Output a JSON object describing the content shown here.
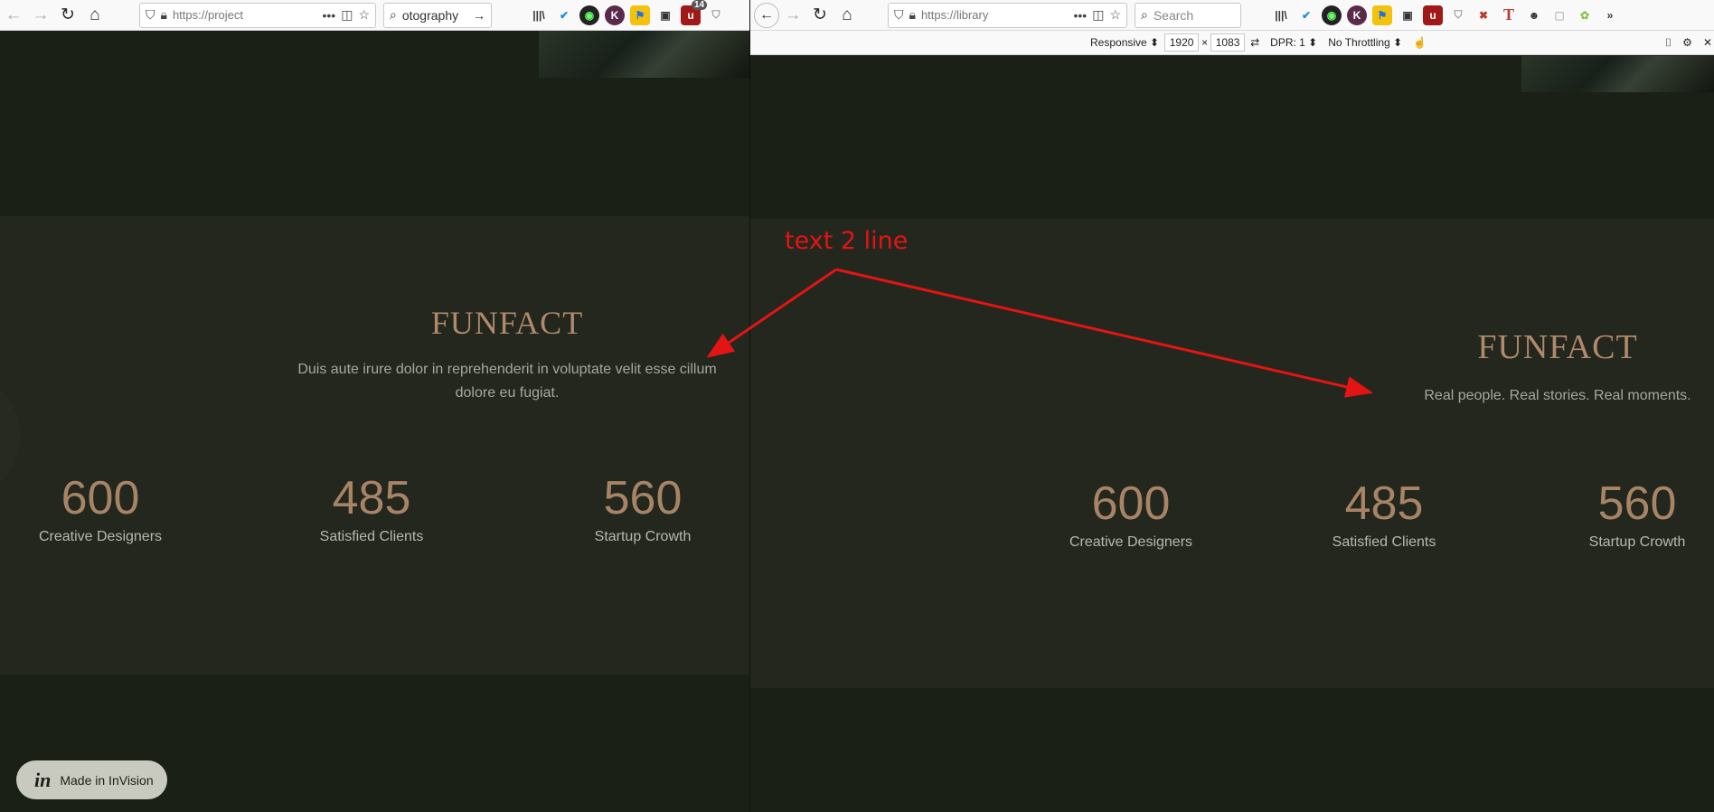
{
  "left": {
    "toolbar": {
      "url": "https://project",
      "search_text": "otography",
      "badge_count": "14"
    },
    "section": {
      "heading": "FUNFACT",
      "description": "Duis aute irure dolor in reprehenderit in voluptate velit esse cillum dolore eu fugiat."
    },
    "stats": [
      {
        "value": "600",
        "label": "Creative Designers"
      },
      {
        "value": "485",
        "label": "Satisfied Clients"
      },
      {
        "value": "560",
        "label": "Startup Crowth"
      }
    ],
    "invision_label": "Made in InVision"
  },
  "right": {
    "toolbar": {
      "url": "https://library",
      "search_placeholder": "Search"
    },
    "rdm": {
      "device": "Responsive ⬍",
      "width": "1920",
      "times": "×",
      "height": "1083",
      "dpr": "DPR: 1 ⬍",
      "throttling": "No Throttling ⬍"
    },
    "section": {
      "heading": "FUNFACT",
      "description": "Real people. Real stories. Real moments."
    },
    "stats": [
      {
        "value": "600",
        "label": "Creative Designers"
      },
      {
        "value": "485",
        "label": "Satisfied Clients"
      },
      {
        "value": "560",
        "label": "Startup Crowth"
      }
    ]
  },
  "annotation": {
    "text": "text 2 line",
    "color": "#e41414"
  },
  "colors": {
    "page_bg": "#1b2016",
    "section_bg": "#23271e",
    "heading": "#b08a6a",
    "stat_number": "#a88466"
  }
}
